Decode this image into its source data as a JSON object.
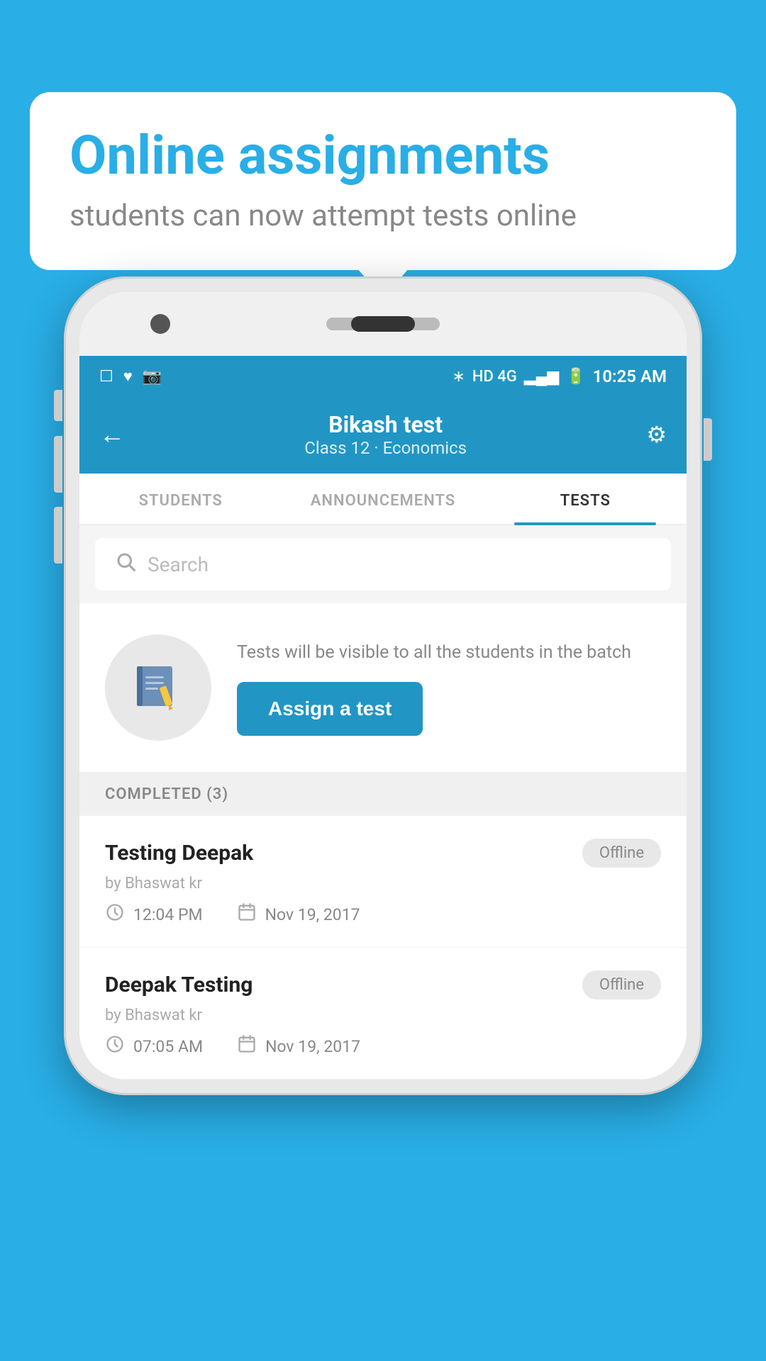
{
  "background_color": "#29aee6",
  "speech_bubble": {
    "title": "Online assignments",
    "subtitle": "students can now attempt tests online"
  },
  "status_bar": {
    "time": "10:25 AM",
    "signal": "HD 4G"
  },
  "header": {
    "title": "Bikash test",
    "subtitle": "Class 12 · Economics",
    "back_label": "←",
    "settings_label": "⚙"
  },
  "tabs": [
    {
      "label": "STUDENTS",
      "active": false
    },
    {
      "label": "ANNOUNCEMENTS",
      "active": false
    },
    {
      "label": "TESTS",
      "active": true
    }
  ],
  "search": {
    "placeholder": "Search"
  },
  "assign_section": {
    "description": "Tests will be visible to all the students in the batch",
    "button_label": "Assign a test"
  },
  "completed_section": {
    "label": "COMPLETED (3)",
    "tests": [
      {
        "name": "Testing Deepak",
        "by": "by Bhaswat kr",
        "time": "12:04 PM",
        "date": "Nov 19, 2017",
        "badge": "Offline"
      },
      {
        "name": "Deepak Testing",
        "by": "by Bhaswat kr",
        "time": "07:05 AM",
        "date": "Nov 19, 2017",
        "badge": "Offline"
      }
    ]
  }
}
